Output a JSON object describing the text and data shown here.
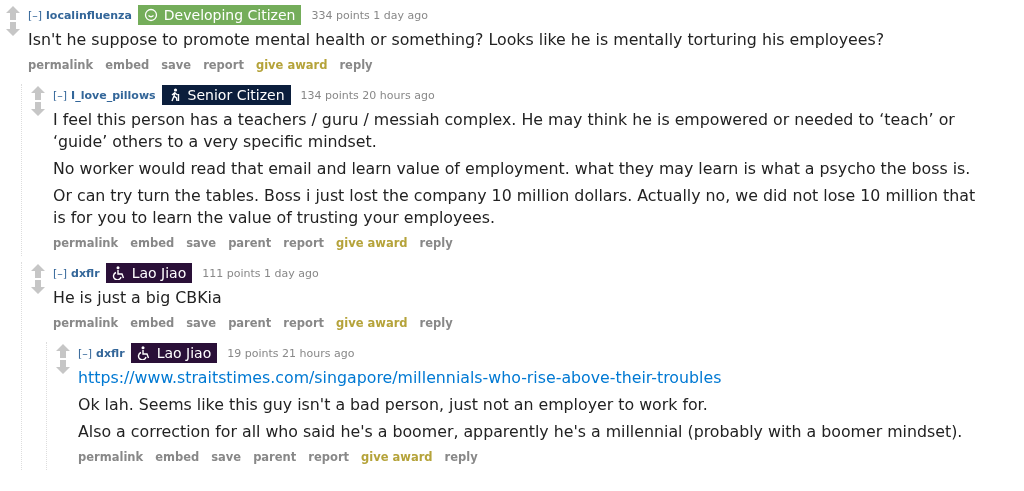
{
  "comments": [
    {
      "toggle": "[–]",
      "author": "localinfluenza",
      "flair": {
        "label": "Developing Citizen",
        "kind": "smiley",
        "color": "#74ad5a"
      },
      "meta": "334 points 1 day ago",
      "body": [
        {
          "kind": "text",
          "text": "Isn't he suppose to promote mental health or something? Looks like he is mentally torturing his employees?"
        }
      ],
      "actions": [
        {
          "label": "permalink",
          "kind": "plain"
        },
        {
          "label": "embed",
          "kind": "plain"
        },
        {
          "label": "save",
          "kind": "plain"
        },
        {
          "label": "report",
          "kind": "plain"
        },
        {
          "label": "give award",
          "kind": "award"
        },
        {
          "label": "reply",
          "kind": "plain"
        }
      ],
      "children": [
        {
          "toggle": "[–]",
          "author": "I_love_pillows",
          "flair": {
            "label": "Senior Citizen",
            "kind": "walker",
            "color": "#0b1e3c"
          },
          "meta": "134 points 20 hours ago",
          "body": [
            {
              "kind": "text",
              "text": "I feel this person has a teachers / guru / messiah complex. He may think he is empowered or needed to ‘teach’ or ‘guide’ others to a very specific mindset."
            },
            {
              "kind": "text",
              "text": "No worker would read that email and learn value of employment. what they may learn is what a psycho the boss is."
            },
            {
              "kind": "text",
              "text": "Or can try turn the tables. Boss i just lost the company 10 million dollars. Actually no, we did not lose 10 million that is for you to learn the value of trusting your employees."
            }
          ],
          "actions": [
            {
              "label": "permalink",
              "kind": "plain"
            },
            {
              "label": "embed",
              "kind": "plain"
            },
            {
              "label": "save",
              "kind": "plain"
            },
            {
              "label": "parent",
              "kind": "plain"
            },
            {
              "label": "report",
              "kind": "plain"
            },
            {
              "label": "give award",
              "kind": "award"
            },
            {
              "label": "reply",
              "kind": "plain"
            }
          ]
        },
        {
          "toggle": "[–]",
          "author": "dxflr",
          "flair": {
            "label": "Lao Jiao",
            "kind": "wheelchair",
            "color": "#2a1038"
          },
          "meta": "111 points 1 day ago",
          "body": [
            {
              "kind": "text",
              "text": "He is just a big CBKia"
            }
          ],
          "actions": [
            {
              "label": "permalink",
              "kind": "plain"
            },
            {
              "label": "embed",
              "kind": "plain"
            },
            {
              "label": "save",
              "kind": "plain"
            },
            {
              "label": "parent",
              "kind": "plain"
            },
            {
              "label": "report",
              "kind": "plain"
            },
            {
              "label": "give award",
              "kind": "award"
            },
            {
              "label": "reply",
              "kind": "plain"
            }
          ],
          "children": [
            {
              "toggle": "[–]",
              "author": "dxflr",
              "flair": {
                "label": "Lao Jiao",
                "kind": "wheelchair",
                "color": "#2a1038"
              },
              "meta": "19 points 21 hours ago",
              "body": [
                {
                  "kind": "link",
                  "text": "https://www.straitstimes.com/singapore/millennials-who-rise-above-their-troubles"
                },
                {
                  "kind": "text",
                  "text": "Ok lah. Seems like this guy isn't a bad person, just not an employer to work for."
                },
                {
                  "kind": "text",
                  "text": "Also a correction for all who said he's a boomer, apparently he's a millennial (probably with a boomer mindset)."
                }
              ],
              "actions": [
                {
                  "label": "permalink",
                  "kind": "plain"
                },
                {
                  "label": "embed",
                  "kind": "plain"
                },
                {
                  "label": "save",
                  "kind": "plain"
                },
                {
                  "label": "parent",
                  "kind": "plain"
                },
                {
                  "label": "report",
                  "kind": "plain"
                },
                {
                  "label": "give award",
                  "kind": "award"
                },
                {
                  "label": "reply",
                  "kind": "plain"
                }
              ]
            }
          ]
        }
      ]
    }
  ]
}
